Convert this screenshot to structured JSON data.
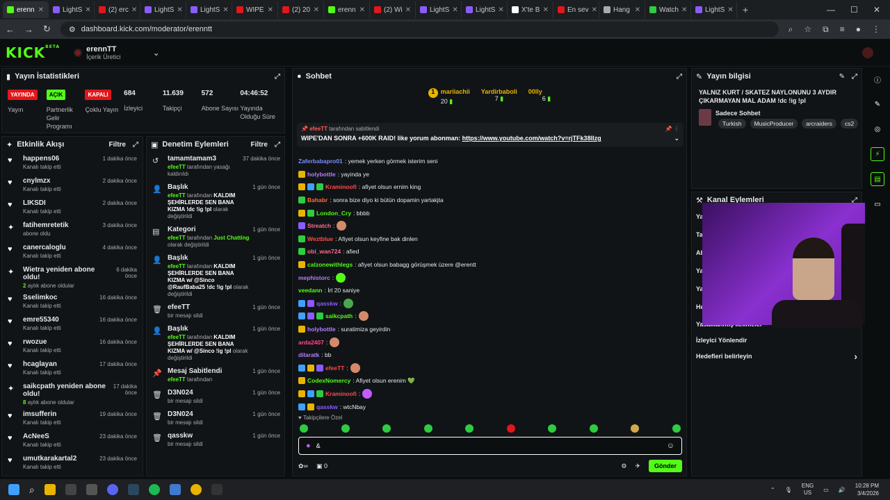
{
  "browser": {
    "tabs": [
      {
        "label": "erenn",
        "color": "#53fc18",
        "active": true
      },
      {
        "label": "LightS",
        "color": "#8a5cff"
      },
      {
        "label": "(2) erc",
        "color": "#e1171a"
      },
      {
        "label": "LightS",
        "color": "#8a5cff"
      },
      {
        "label": "LightS",
        "color": "#8a5cff"
      },
      {
        "label": "WIPE",
        "color": "#e1171a"
      },
      {
        "label": "(2) 20",
        "color": "#e1171a"
      },
      {
        "label": "erenn",
        "color": "#53fc18"
      },
      {
        "label": "(2) Wi",
        "color": "#e1171a"
      },
      {
        "label": "LightS",
        "color": "#8a5cff"
      },
      {
        "label": "LightS",
        "color": "#8a5cff"
      },
      {
        "label": "X'te B",
        "color": "#ffffff"
      },
      {
        "label": "En sev",
        "color": "#e1171a"
      },
      {
        "label": "Hang",
        "color": "#aaaaaa"
      },
      {
        "label": "Watch",
        "color": "#2ecc40"
      },
      {
        "label": "LightS",
        "color": "#8a5cff"
      }
    ],
    "url": "dashboard.kick.com/moderator/erenntt"
  },
  "kick": {
    "logo": "KICK",
    "logo_sup": "BETA",
    "channel_name": "erennTT",
    "channel_role": "İçerik Üretici"
  },
  "stats": {
    "title": "Yayın İstatistikleri",
    "items": [
      {
        "badge": "YAYINDA",
        "badge_color": "red",
        "label": "Yayın"
      },
      {
        "badge": "AÇIK",
        "badge_color": "green",
        "label": "Partnerlik Gelir Programı"
      },
      {
        "badge": "KAPALI",
        "badge_color": "red",
        "label": "Çoklu Yayın"
      },
      {
        "num": "684",
        "label": "İzleyici"
      },
      {
        "num": "11.639",
        "label": "Takipçi"
      },
      {
        "num": "572",
        "label": "Abone Sayısı"
      },
      {
        "num": "04:46:52",
        "label": "Yayında Olduğu Süre"
      }
    ]
  },
  "activity": {
    "title": "Etkinlik Akışı",
    "filter": "Filtre",
    "items": [
      {
        "icon": "heart",
        "name": "happens06",
        "sub": "Kanalı takip etti",
        "time": "1 dakika önce"
      },
      {
        "icon": "heart",
        "name": "cnylmzx",
        "sub": "Kanalı takip etti",
        "time": "2 dakika önce"
      },
      {
        "icon": "heart",
        "name": "LIKSDI",
        "sub": "Kanalı takip etti",
        "time": "2 dakika önce"
      },
      {
        "icon": "star",
        "name": "fatihemretetik",
        "sub": "abone oldu",
        "time": "3 dakika önce"
      },
      {
        "icon": "heart",
        "name": "canercaloglu",
        "sub": "Kanalı takip etti",
        "time": "4 dakika önce"
      },
      {
        "icon": "star",
        "name": "Wietra yeniden abone oldu!",
        "sub_hl": "2",
        "sub": "aylık abone oldular",
        "time": "6 dakika önce"
      },
      {
        "icon": "heart",
        "name": "Sselimkoc",
        "sub": "Kanalı takip etti",
        "time": "16 dakika önce"
      },
      {
        "icon": "heart",
        "name": "emre55340",
        "sub": "Kanalı takip etti",
        "time": "16 dakika önce"
      },
      {
        "icon": "heart",
        "name": "rwozue",
        "sub": "Kanalı takip etti",
        "time": "16 dakika önce"
      },
      {
        "icon": "heart",
        "name": "hcaglayan",
        "sub": "Kanalı takip etti",
        "time": "17 dakika önce"
      },
      {
        "icon": "star",
        "name": "saikcpath yeniden abone oldu!",
        "sub_hl": "8",
        "sub": "aylık abone oldular",
        "time": "17 dakika önce"
      },
      {
        "icon": "heart",
        "name": "imsufferin",
        "sub": "Kanalı takip etti",
        "time": "19 dakika önce"
      },
      {
        "icon": "heart",
        "name": "AcNeeS",
        "sub": "Kanalı takip etti",
        "time": "23 dakika önce"
      },
      {
        "icon": "heart",
        "name": "umutkarakartal2",
        "sub": "Kanalı takip etti",
        "time": "23 dakika önce"
      }
    ]
  },
  "modactions": {
    "title": "Denetim Eylemleri",
    "filter": "Filtre",
    "items": [
      {
        "icon": "unban",
        "title": "tamamtamam3",
        "pre": "efeeTT",
        "sub": "tarafından yasağı kaldırıldı",
        "time": "37 dakika önce"
      },
      {
        "icon": "title",
        "title": "Başlık",
        "pre": "efeeTT",
        "sub": "tarafından",
        "bold": "KALDIM ŞEHİRLERDE SEN BANA KIZMA !dc !ig !pl",
        "post": "olarak değiştirildi",
        "time": "1 gün önce"
      },
      {
        "icon": "category",
        "title": "Kategori",
        "pre": "efeeTT",
        "sub": "tarafından",
        "green": "Just Chatting",
        "post": "olarak değiştirildi",
        "time": "1 gün önce"
      },
      {
        "icon": "title",
        "title": "Başlık",
        "pre": "efeeTT",
        "sub": "tarafından",
        "bold": "KALDIM ŞEHİRLERDE SEN BANA KIZMA w/ @Sinco @RaufBaba25 !dc !ig !pl",
        "post": "olarak değiştirildi",
        "time": "1 gün önce"
      },
      {
        "icon": "trash",
        "title": "efeeTT",
        "sub": "bir mesajı sildi",
        "time": "1 gün önce"
      },
      {
        "icon": "title",
        "title": "Başlık",
        "pre": "efeeTT",
        "sub": "tarafından",
        "bold": "KALDIM ŞEHİRLERDE SEN BANA KIZMA w/ @Sinco !ig !pl",
        "post": "olarak değiştirildi",
        "time": "1 gün önce"
      },
      {
        "icon": "pin",
        "title": "Mesaj Sabitlendi",
        "pre": "efeeTT",
        "sub": "tarafından",
        "time": "1 gün önce"
      },
      {
        "icon": "trash",
        "title": "D3N024",
        "sub": "bir mesajı sildi",
        "time": "1 gün önce"
      },
      {
        "icon": "trash",
        "title": "D3N024",
        "sub": "bir mesajı sildi",
        "time": "1 gün önce"
      },
      {
        "icon": "trash",
        "title": "qasskw",
        "sub": "bir mesajı sildi",
        "time": "1 gün önce"
      }
    ]
  },
  "chat": {
    "title": "Sohbet",
    "leaders": [
      {
        "rank": "1",
        "name": "mariiachii",
        "num": "20"
      },
      {
        "name": "Yardirbaboli",
        "num": "7"
      },
      {
        "name": "00lly",
        "num": "6"
      }
    ],
    "pinned_by": "efeeTT",
    "pinned_label": "tarafından sabitlendi",
    "pinned_text": "WIPE'DAN SONRA +600K RAID! like yorum abonman:",
    "pinned_link": "https://www.youtube.com/watch?v=rjTFk38llzg",
    "messages": [
      {
        "user": "Zaferbabapro01",
        "color": "#7a8cff",
        "text": ": yemek yerken görmek isterim seni",
        "badges": []
      },
      {
        "user": "holybottle",
        "color": "#b57cff",
        "text": ": yayinda ye",
        "badges": [
          "#e8b400"
        ]
      },
      {
        "user": "Kraminoofi",
        "color": "#ff4a4a",
        "text": ": afiyet olsun ernim king",
        "badges": [
          "#e8b400",
          "#3fa0ff",
          "#2ecc40"
        ]
      },
      {
        "user": "Bahabr",
        "color": "#ff6b3a",
        "text": ": sonra bize diyo ki bütün dopamin yartakjta",
        "badges": [
          "#2ecc40"
        ]
      },
      {
        "user": "London_Cry",
        "color": "#53fc18",
        "text": ": bbbb",
        "badges": [
          "#e8b400",
          "#2ecc40"
        ]
      },
      {
        "user": "Streatch",
        "color": "#ff6b8a",
        "text": ":",
        "badges": [
          "#8a5cff"
        ],
        "emote": "#d48a6a"
      },
      {
        "user": "Weztblue",
        "color": "#ff4a4a",
        "text": ": Afiyet olsun keyfine bak dinlen",
        "badges": [
          "#2ecc40"
        ]
      },
      {
        "user": "obi_wan724",
        "color": "#ff6b8a",
        "text": ": afied",
        "badges": [
          "#2ecc40"
        ]
      },
      {
        "user": "calzonewithlegs",
        "color": "#53fc18",
        "text": ": afiyet olsun babagg görüşmek üzere @erentt",
        "badges": [
          "#e8b400"
        ]
      },
      {
        "user": "mephistorc",
        "color": "#b57cff",
        "text": ":",
        "badges": [],
        "emote": "#53fc18"
      },
      {
        "user": "veedann",
        "color": "#53fc18",
        "text": ": İrl 20 saniye",
        "badges": []
      },
      {
        "user": "qasskw",
        "color": "#8a5cff",
        "text": ":",
        "badges": [
          "#3fa0ff",
          "#8a5cff"
        ],
        "emote": "#4aa84a"
      },
      {
        "user": "saikcpath",
        "color": "#53fc18",
        "text": ":",
        "badges": [
          "#3fa0ff",
          "#8a5cff",
          "#2ecc40"
        ],
        "emote": "#d48a6a"
      },
      {
        "user": "holybottle",
        "color": "#b57cff",
        "text": ": suratimiza geyirdin",
        "badges": [
          "#e8b400"
        ]
      },
      {
        "user": "arda2407",
        "color": "#ff4a8a",
        "text": ":",
        "badges": [],
        "emote": "#d48a6a"
      },
      {
        "user": "dilaratk",
        "color": "#b57cff",
        "text": ": bb",
        "badges": []
      },
      {
        "user": "efeeTT",
        "color": "#ff4a4a",
        "text": ":",
        "badges": [
          "#3fa0ff",
          "#e8b400",
          "#8a5cff"
        ],
        "emote": "#d48a6a"
      },
      {
        "user": "CodexNomercy",
        "color": "#53fc18",
        "text": ": Afiyet olsun erenim 💚",
        "badges": [
          "#e8b400"
        ]
      },
      {
        "user": "Kraminoofi",
        "color": "#ff4a4a",
        "text": ":",
        "badges": [
          "#e8b400",
          "#3fa0ff",
          "#2ecc40"
        ],
        "emote": "#c25cff"
      },
      {
        "user": "qasskw",
        "color": "#8a5cff",
        "text": ": wtcNbay",
        "badges": [
          "#3fa0ff",
          "#e8b400"
        ]
      }
    ],
    "followers_only": "Takipçilere Özel",
    "input_value": "&",
    "foot_count": "0",
    "send": "Gönder"
  },
  "info": {
    "title": "Yayın bilgisi",
    "stream_title": "YALNIZ KURT / SKATEZ NAYLONUNU 3 AYDIR ÇIKARMAYAN MAL ADAM !dc !ig !pl",
    "category": "Sadece Sohbet",
    "tags": [
      "Turkish",
      "MusicProducer",
      "arcraiders",
      "cs2"
    ]
  },
  "channel_actions": {
    "title": "Kanal Eylemleri",
    "hidden_items": [
      "Yay",
      "Tal",
      "Ab",
      "Yay",
      "Yay",
      "He"
    ],
    "items": [
      {
        "label": "Yasaklanmış kelimeler",
        "arrow": true
      },
      {
        "label": "İzleyici Yönlendir",
        "arrow": false
      },
      {
        "label": "Hedefleri belirleyin",
        "arrow": true
      }
    ]
  },
  "taskbar": {
    "lang1": "ENG",
    "lang2": "US",
    "time": "10:28 PM",
    "date": "3/4/2026"
  }
}
